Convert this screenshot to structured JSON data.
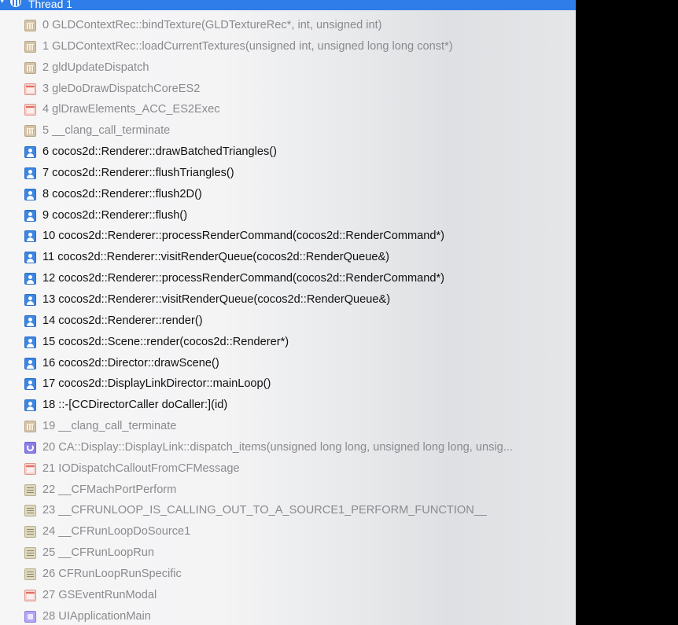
{
  "thread": {
    "title": "Thread 1",
    "disclosure_icon": "chevron-down-icon",
    "icon": "thread-icon",
    "accent_color": "#2f7de8"
  },
  "frames": [
    {
      "label": "0 GLDContextRec::bindTexture(GLDTextureRec*, int, unsigned int)",
      "icon": "library-icon",
      "style": "muted",
      "kind": "lib"
    },
    {
      "label": "1 GLDContextRec::loadCurrentTextures(unsigned int, unsigned long long const*)",
      "icon": "library-icon",
      "style": "muted",
      "kind": "lib"
    },
    {
      "label": "2 gldUpdateDispatch",
      "icon": "library-icon",
      "style": "muted",
      "kind": "lib"
    },
    {
      "label": "3 gleDoDrawDispatchCoreES2",
      "icon": "driver-icon",
      "style": "muted",
      "kind": "drv"
    },
    {
      "label": "4 glDrawElements_ACC_ES2Exec",
      "icon": "driver-icon",
      "style": "muted",
      "kind": "drv"
    },
    {
      "label": "5 __clang_call_terminate",
      "icon": "library-icon",
      "style": "muted",
      "kind": "lib"
    },
    {
      "label": "6 cocos2d::Renderer::drawBatchedTriangles()",
      "icon": "user-code-icon",
      "style": "user",
      "kind": "person"
    },
    {
      "label": "7 cocos2d::Renderer::flushTriangles()",
      "icon": "user-code-icon",
      "style": "user",
      "kind": "person"
    },
    {
      "label": "8 cocos2d::Renderer::flush2D()",
      "icon": "user-code-icon",
      "style": "user",
      "kind": "person"
    },
    {
      "label": "9 cocos2d::Renderer::flush()",
      "icon": "user-code-icon",
      "style": "user",
      "kind": "person"
    },
    {
      "label": "10 cocos2d::Renderer::processRenderCommand(cocos2d::RenderCommand*)",
      "icon": "user-code-icon",
      "style": "user",
      "kind": "person"
    },
    {
      "label": "11 cocos2d::Renderer::visitRenderQueue(cocos2d::RenderQueue&)",
      "icon": "user-code-icon",
      "style": "user",
      "kind": "person"
    },
    {
      "label": "12 cocos2d::Renderer::processRenderCommand(cocos2d::RenderCommand*)",
      "icon": "user-code-icon",
      "style": "user",
      "kind": "person"
    },
    {
      "label": "13 cocos2d::Renderer::visitRenderQueue(cocos2d::RenderQueue&)",
      "icon": "user-code-icon",
      "style": "user",
      "kind": "person"
    },
    {
      "label": "14 cocos2d::Renderer::render()",
      "icon": "user-code-icon",
      "style": "user",
      "kind": "person"
    },
    {
      "label": "15 cocos2d::Scene::render(cocos2d::Renderer*)",
      "icon": "user-code-icon",
      "style": "user",
      "kind": "person"
    },
    {
      "label": "16 cocos2d::Director::drawScene()",
      "icon": "user-code-icon",
      "style": "user",
      "kind": "person"
    },
    {
      "label": "17 cocos2d::DisplayLinkDirector::mainLoop()",
      "icon": "user-code-icon",
      "style": "user",
      "kind": "person"
    },
    {
      "label": "18 ::-[CCDirectorCaller doCaller:](id)",
      "icon": "user-code-icon",
      "style": "user",
      "kind": "person"
    },
    {
      "label": "19 __clang_call_terminate",
      "icon": "library-icon",
      "style": "muted",
      "kind": "lib"
    },
    {
      "label": "20 CA::Display::DisplayLink::dispatch_items(unsigned long long, unsigned long long, unsig...",
      "icon": "core-animation-icon",
      "style": "muted",
      "kind": "ca"
    },
    {
      "label": "21 IODispatchCalloutFromCFMessage",
      "icon": "driver-icon",
      "style": "muted",
      "kind": "drv"
    },
    {
      "label": "22 __CFMachPortPerform",
      "icon": "core-foundation-icon",
      "style": "muted",
      "kind": "cf"
    },
    {
      "label": "23 __CFRUNLOOP_IS_CALLING_OUT_TO_A_SOURCE1_PERFORM_FUNCTION__",
      "icon": "core-foundation-icon",
      "style": "muted",
      "kind": "cf"
    },
    {
      "label": "24 __CFRunLoopDoSource1",
      "icon": "core-foundation-icon",
      "style": "muted",
      "kind": "cf"
    },
    {
      "label": "25 __CFRunLoopRun",
      "icon": "core-foundation-icon",
      "style": "muted",
      "kind": "cf"
    },
    {
      "label": "26 CFRunLoopRunSpecific",
      "icon": "core-foundation-icon",
      "style": "muted",
      "kind": "cf"
    },
    {
      "label": "27 GSEventRunModal",
      "icon": "driver-icon",
      "style": "muted",
      "kind": "drv"
    },
    {
      "label": "28 UIApplicationMain",
      "icon": "uikit-icon",
      "style": "muted",
      "kind": "uikit"
    }
  ]
}
